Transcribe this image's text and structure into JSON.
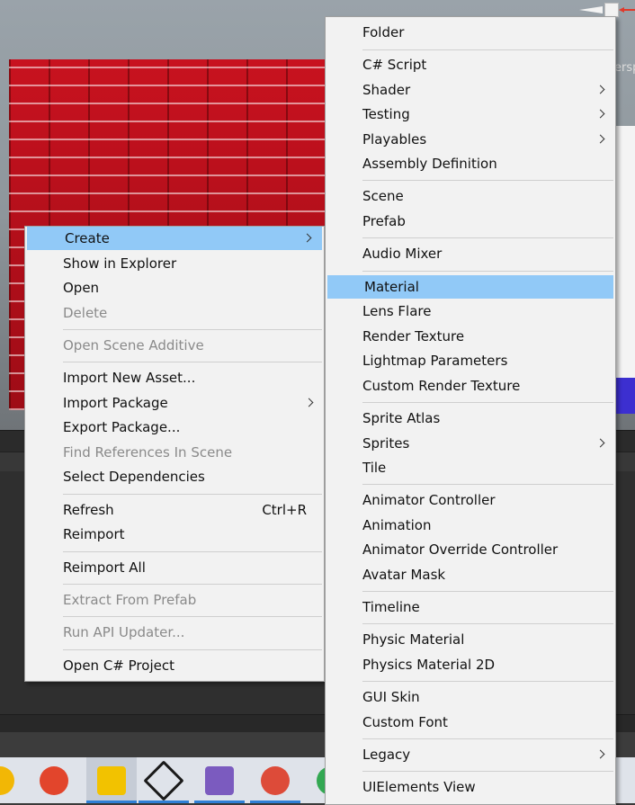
{
  "scene": {
    "persp_label": "ersp"
  },
  "left_menu": {
    "items": [
      {
        "label": "Create",
        "submenu": true,
        "highlighted": true
      },
      {
        "label": "Show in Explorer"
      },
      {
        "label": "Open"
      },
      {
        "label": "Delete",
        "disabled": true
      },
      {
        "label": "Open Scene Additive",
        "disabled": true
      },
      {
        "label": "Import New Asset..."
      },
      {
        "label": "Import Package",
        "submenu": true
      },
      {
        "label": "Export Package..."
      },
      {
        "label": "Find References In Scene",
        "disabled": true
      },
      {
        "label": "Select Dependencies"
      },
      {
        "label": "Refresh",
        "shortcut": "Ctrl+R"
      },
      {
        "label": "Reimport"
      },
      {
        "label": "Reimport All"
      },
      {
        "label": "Extract From Prefab",
        "disabled": true
      },
      {
        "label": "Run API Updater...",
        "disabled": true
      },
      {
        "label": "Open C# Project"
      }
    ]
  },
  "right_menu": {
    "items": [
      {
        "label": "Folder"
      },
      {
        "label": "C# Script"
      },
      {
        "label": "Shader",
        "submenu": true
      },
      {
        "label": "Testing",
        "submenu": true
      },
      {
        "label": "Playables",
        "submenu": true
      },
      {
        "label": "Assembly Definition"
      },
      {
        "label": "Scene"
      },
      {
        "label": "Prefab"
      },
      {
        "label": "Audio Mixer"
      },
      {
        "label": "Material",
        "highlighted": true
      },
      {
        "label": "Lens Flare"
      },
      {
        "label": "Render Texture"
      },
      {
        "label": "Lightmap Parameters"
      },
      {
        "label": "Custom Render Texture"
      },
      {
        "label": "Sprite Atlas"
      },
      {
        "label": "Sprites",
        "submenu": true
      },
      {
        "label": "Tile"
      },
      {
        "label": "Animator Controller"
      },
      {
        "label": "Animation"
      },
      {
        "label": "Animator Override Controller"
      },
      {
        "label": "Avatar Mask"
      },
      {
        "label": "Timeline"
      },
      {
        "label": "Physic Material"
      },
      {
        "label": "Physics Material 2D"
      },
      {
        "label": "GUI Skin"
      },
      {
        "label": "Custom Font"
      },
      {
        "label": "Legacy",
        "submenu": true
      },
      {
        "label": "UIElements View"
      }
    ]
  },
  "taskbar": {
    "apps": [
      {
        "icon": "app-icon-yellow",
        "accent": "#f2b705"
      },
      {
        "icon": "spiral-app-icon",
        "accent": "#e2452c"
      },
      {
        "icon": "pin-app-icon",
        "accent": "#f2c200"
      },
      {
        "icon": "unity-icon",
        "accent": "#1a1a1a"
      },
      {
        "icon": "visual-studio-icon",
        "accent": "#7b5bbf"
      },
      {
        "icon": "chrome-icon",
        "accent": "#dd4b39"
      },
      {
        "icon": "app-icon-green",
        "accent": "#33a852"
      }
    ]
  }
}
